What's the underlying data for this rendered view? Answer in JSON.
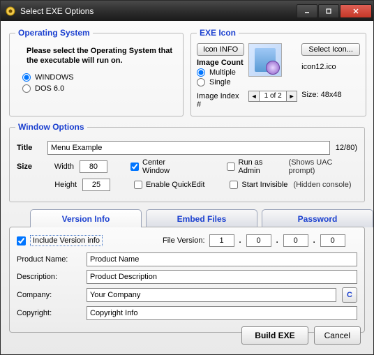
{
  "window": {
    "title": "Select EXE Options"
  },
  "os": {
    "legend": "Operating System",
    "prompt": "Please select the Operating System that the executable will run on.",
    "options": {
      "windows": "WINDOWS",
      "dos": "DOS 6.0"
    }
  },
  "icon": {
    "legend": "EXE Icon",
    "info_btn": "Icon INFO",
    "select_btn": "Select Icon...",
    "filename": "icon12.ico",
    "image_count_label": "Image Count",
    "multiple": "Multiple",
    "single": "Single",
    "index_label": "Image Index #",
    "index_value": "1 of 2",
    "size_label": "Size: 48x48"
  },
  "winopt": {
    "legend": "Window Options",
    "title_label": "Title",
    "title_value": "Menu Example",
    "title_count": "12/80)",
    "size_label": "Size",
    "width_label": "Width",
    "width_value": "80",
    "height_label": "Height",
    "height_value": "25",
    "center": "Center Window",
    "quickedit": "Enable QuickEdit",
    "runadmin": "Run as Admin",
    "runadmin_hint": "(Shows UAC prompt)",
    "invisible": "Start Invisible",
    "invisible_hint": "(Hidden console)"
  },
  "tabs": {
    "version": "Version Info",
    "embed": "Embed Files",
    "password": "Password"
  },
  "version": {
    "include": "Include Version info",
    "fv_label": "File Version:",
    "fv": [
      "1",
      "0",
      "0",
      "0"
    ],
    "product_label": "Product Name:",
    "product_value": "Product Name",
    "desc_label": "Description:",
    "desc_value": "Product Description",
    "company_label": "Company:",
    "company_value": "Your Company",
    "copyright_label": "Copyright:",
    "copyright_value": "Copyright Info"
  },
  "footer": {
    "build": "Build EXE",
    "cancel": "Cancel"
  }
}
